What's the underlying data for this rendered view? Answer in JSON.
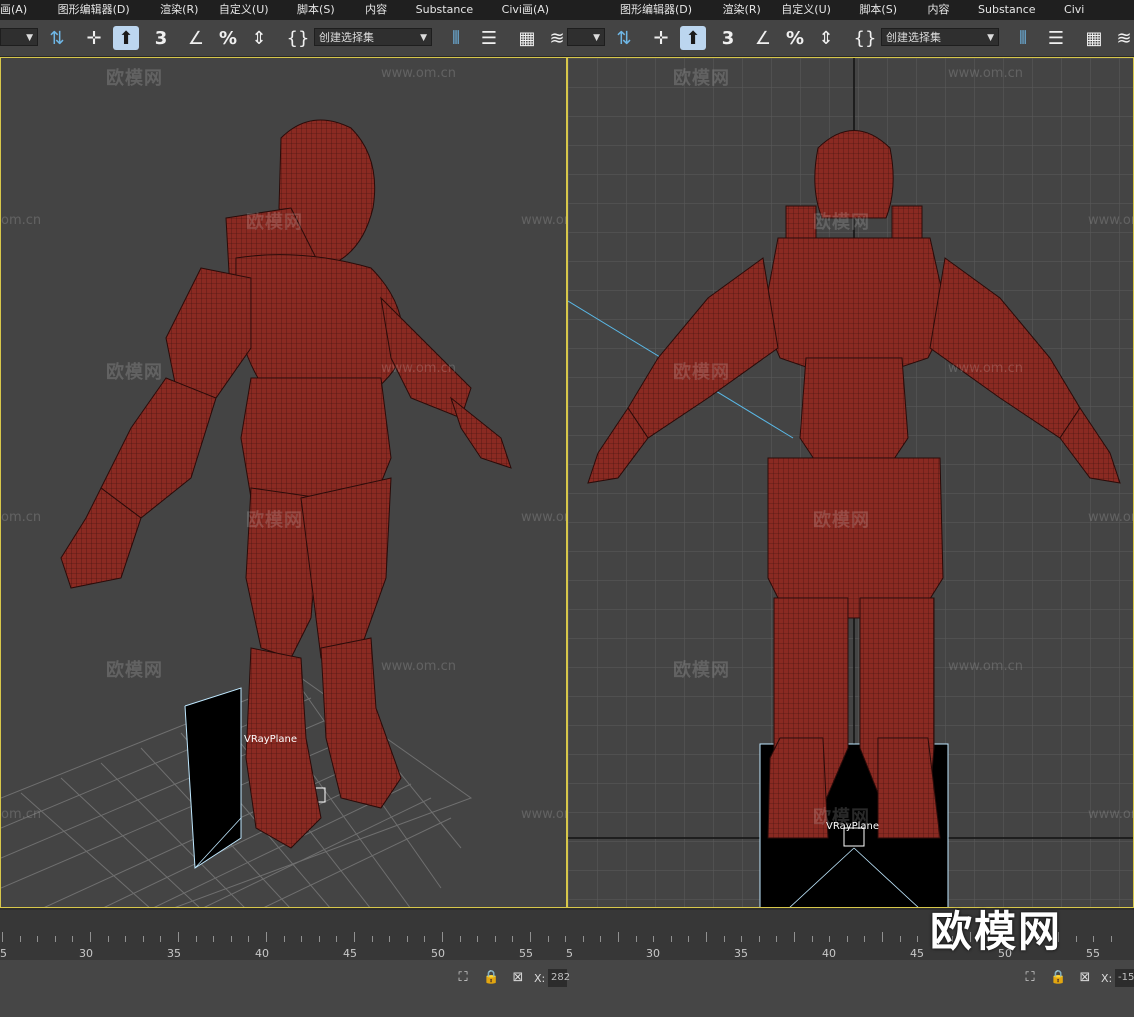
{
  "menu": [
    "图形编辑器(D)",
    "渲染(R)",
    "自定义(U)",
    "脚本(S)",
    "内容",
    "Substance",
    "Civil View(A)"
  ],
  "menu_left_fragment": "画(A)",
  "menu_right_fragment": "Civi",
  "menu_civil_short": "Civi画(A)",
  "toolbar": {
    "selection_set": "创建选择集"
  },
  "viewport_left": {
    "object_label": "VRayPlane"
  },
  "viewport_right": {
    "object_label": "VRayPlane"
  },
  "watermark": {
    "text": "欧模网",
    "url": "www.om.cn",
    "url_short": "om.cn",
    "corner": "欧模网"
  },
  "timeline": {
    "labels_left": [
      "5",
      "30",
      "35",
      "40",
      "45",
      "50",
      "55"
    ],
    "labels_right": [
      "5",
      "30",
      "35",
      "40",
      "45",
      "50",
      "55"
    ]
  },
  "status": {
    "x_label": "X:",
    "x_value_left": "282",
    "x_value_right": "-15"
  },
  "colors": {
    "viewport_border": "#d7c74a",
    "model": "#8a2a22",
    "background": "#444444"
  }
}
